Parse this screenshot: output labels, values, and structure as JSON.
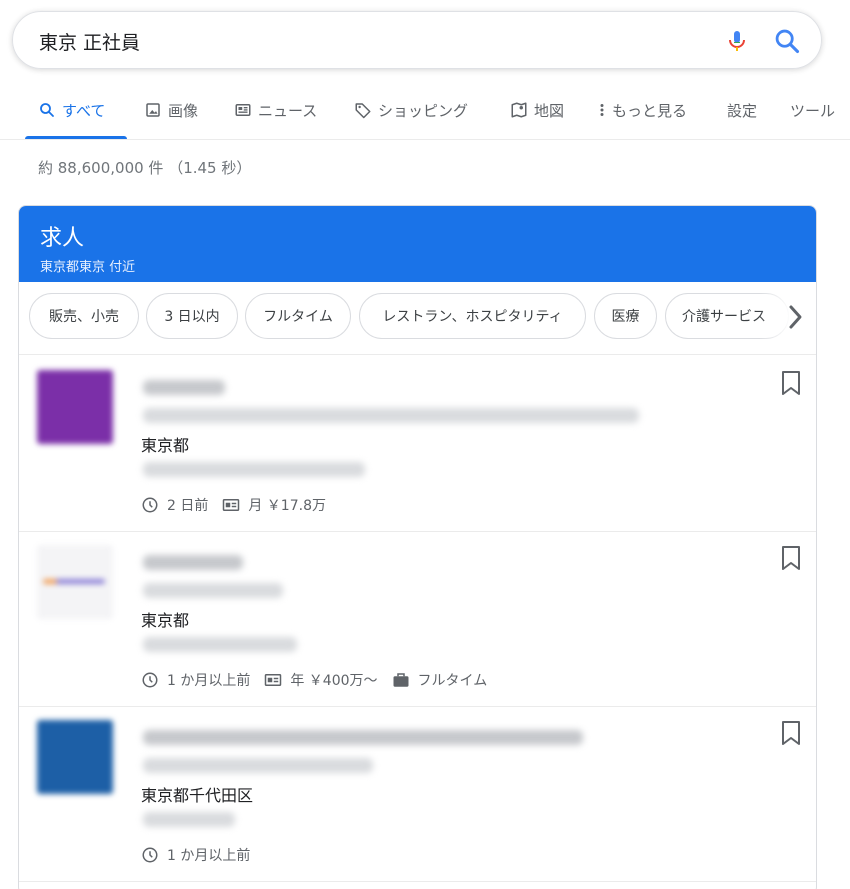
{
  "search": {
    "query": "東京 正社員"
  },
  "tabs": [
    {
      "label": "すべて",
      "icon": "search-icon",
      "active": true
    },
    {
      "label": "画像",
      "icon": "image-icon"
    },
    {
      "label": "ニュース",
      "icon": "news-icon"
    },
    {
      "label": "ショッピング",
      "icon": "tag-icon"
    },
    {
      "label": "地図",
      "icon": "map-icon"
    },
    {
      "label": "もっと見る",
      "icon": "more-vert-icon"
    },
    {
      "label": "設定"
    },
    {
      "label": "ツール"
    }
  ],
  "result_stats": "約 88,600,000 件 （1.45 秒）",
  "jobs_card": {
    "title": "求人",
    "subtitle": "東京都東京 付近",
    "chips": [
      "販売、小売",
      "3 日以内",
      "フルタイム",
      "レストラン、ホスピタリティ",
      "医療",
      "介護サービス"
    ],
    "jobs": [
      {
        "location": "東京都",
        "posted": "2 日前",
        "salary": "月 ￥17.8万",
        "type": "",
        "logo_color": "#7b2fa8"
      },
      {
        "location": "東京都",
        "posted": "1 か月以上前",
        "salary": "年 ￥400万〜",
        "type": "フルタイム",
        "logo_color": "#f4f4f6"
      },
      {
        "location": "東京都千代田区",
        "posted": "1 か月以上前",
        "salary": "",
        "type": "",
        "logo_color": "#1d5fa6"
      }
    ]
  },
  "colors": {
    "accent": "#1a73e8",
    "text_secondary": "#5f6368"
  }
}
